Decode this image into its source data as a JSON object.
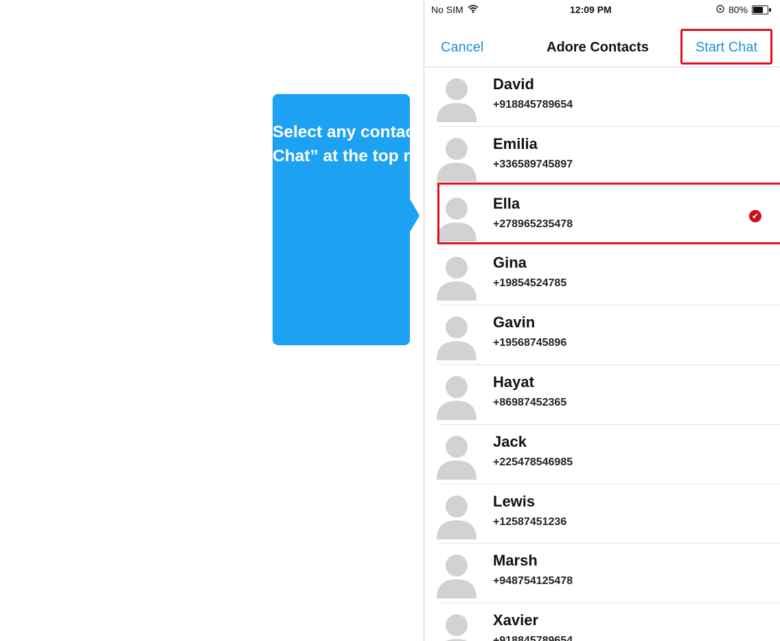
{
  "callout": {
    "line1": "Select any contact and click on “Start",
    "line2": "Chat” at the top right hand corner."
  },
  "status_bar": {
    "carrier": "No SIM",
    "time": "12:09 PM",
    "battery": "80%",
    "battery_level": 0.8
  },
  "nav": {
    "cancel": "Cancel",
    "title": "Adore Contacts",
    "start_chat": "Start Chat"
  },
  "contacts": [
    {
      "name": "David",
      "phone": "+918845789654",
      "selected": false
    },
    {
      "name": "Emilia",
      "phone": "+336589745897",
      "selected": false
    },
    {
      "name": "Ella",
      "phone": "+278965235478",
      "selected": true
    },
    {
      "name": "Gina",
      "phone": "+19854524785",
      "selected": false
    },
    {
      "name": "Gavin",
      "phone": "+19568745896",
      "selected": false
    },
    {
      "name": "Hayat",
      "phone": "+86987452365",
      "selected": false
    },
    {
      "name": "Jack",
      "phone": "+225478546985",
      "selected": false
    },
    {
      "name": "Lewis",
      "phone": "+12587451236",
      "selected": false
    },
    {
      "name": "Marsh",
      "phone": "+948754125478",
      "selected": false
    },
    {
      "name": "Xavier",
      "phone": "+918845789654",
      "selected": false
    }
  ],
  "colors": {
    "callout_bg": "#1da1f2",
    "highlight_border": "#e0101a",
    "link_blue": "#1e8fd6",
    "check_red": "#c8121c"
  }
}
